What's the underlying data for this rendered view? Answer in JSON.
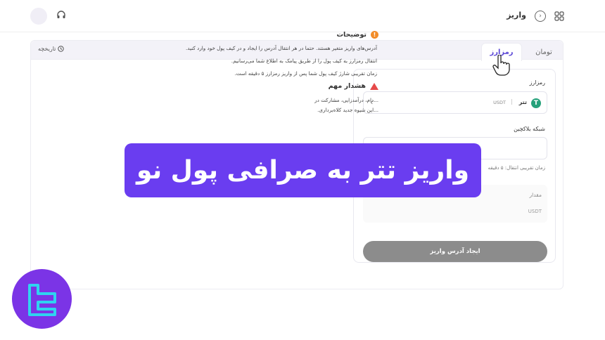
{
  "header": {
    "title": "واریز",
    "icons": [
      "avatar",
      "headset-icon",
      "back-arrow-icon",
      "grid-icon"
    ]
  },
  "tabs": {
    "crypto": "رمزارز",
    "toman": "تومان",
    "history": "تاریخچه"
  },
  "form": {
    "coin_label": "رمزارز",
    "coin_name": "تتر",
    "coin_symbol": "USDT",
    "network_label": "شبکه بلاکچین",
    "time_note": "زمان تقریبی انتقال: ۵ دقیقه",
    "amount_label": "مقدار",
    "amount_unit": "USDT",
    "create_button": "ایجاد آدرس واریز"
  },
  "info": {
    "title": "توضیحات",
    "lines": [
      "آدرس‌های واریز متغیر هستند. حتما در هر انتقال آدرس را ایجاد و در کیف پول خود وارد کنید.",
      "انتقال رمزارز به کیف پول را از طریق پیامک به اطلاع شما می‌رسانیم.",
      "زمان تقریبی شارژ کیف پول شما پس از واریز رمزارز ۵ دقیقه است."
    ],
    "warning_title": "هشدار مهم",
    "warning_lines": [
      "...دام، درآمدزایی، مشارکت در",
      "...این شیوه جدید کلاه‌برداری."
    ]
  },
  "banner": {
    "text": "واریز تتر به صرافی پول نو"
  },
  "colors": {
    "accent": "#5b47d6",
    "banner": "#6a3df0",
    "tether": "#26a17b",
    "button_disabled": "#8c8c8c",
    "info_icon": "#f28c28",
    "warning_icon": "#e64a4a"
  }
}
